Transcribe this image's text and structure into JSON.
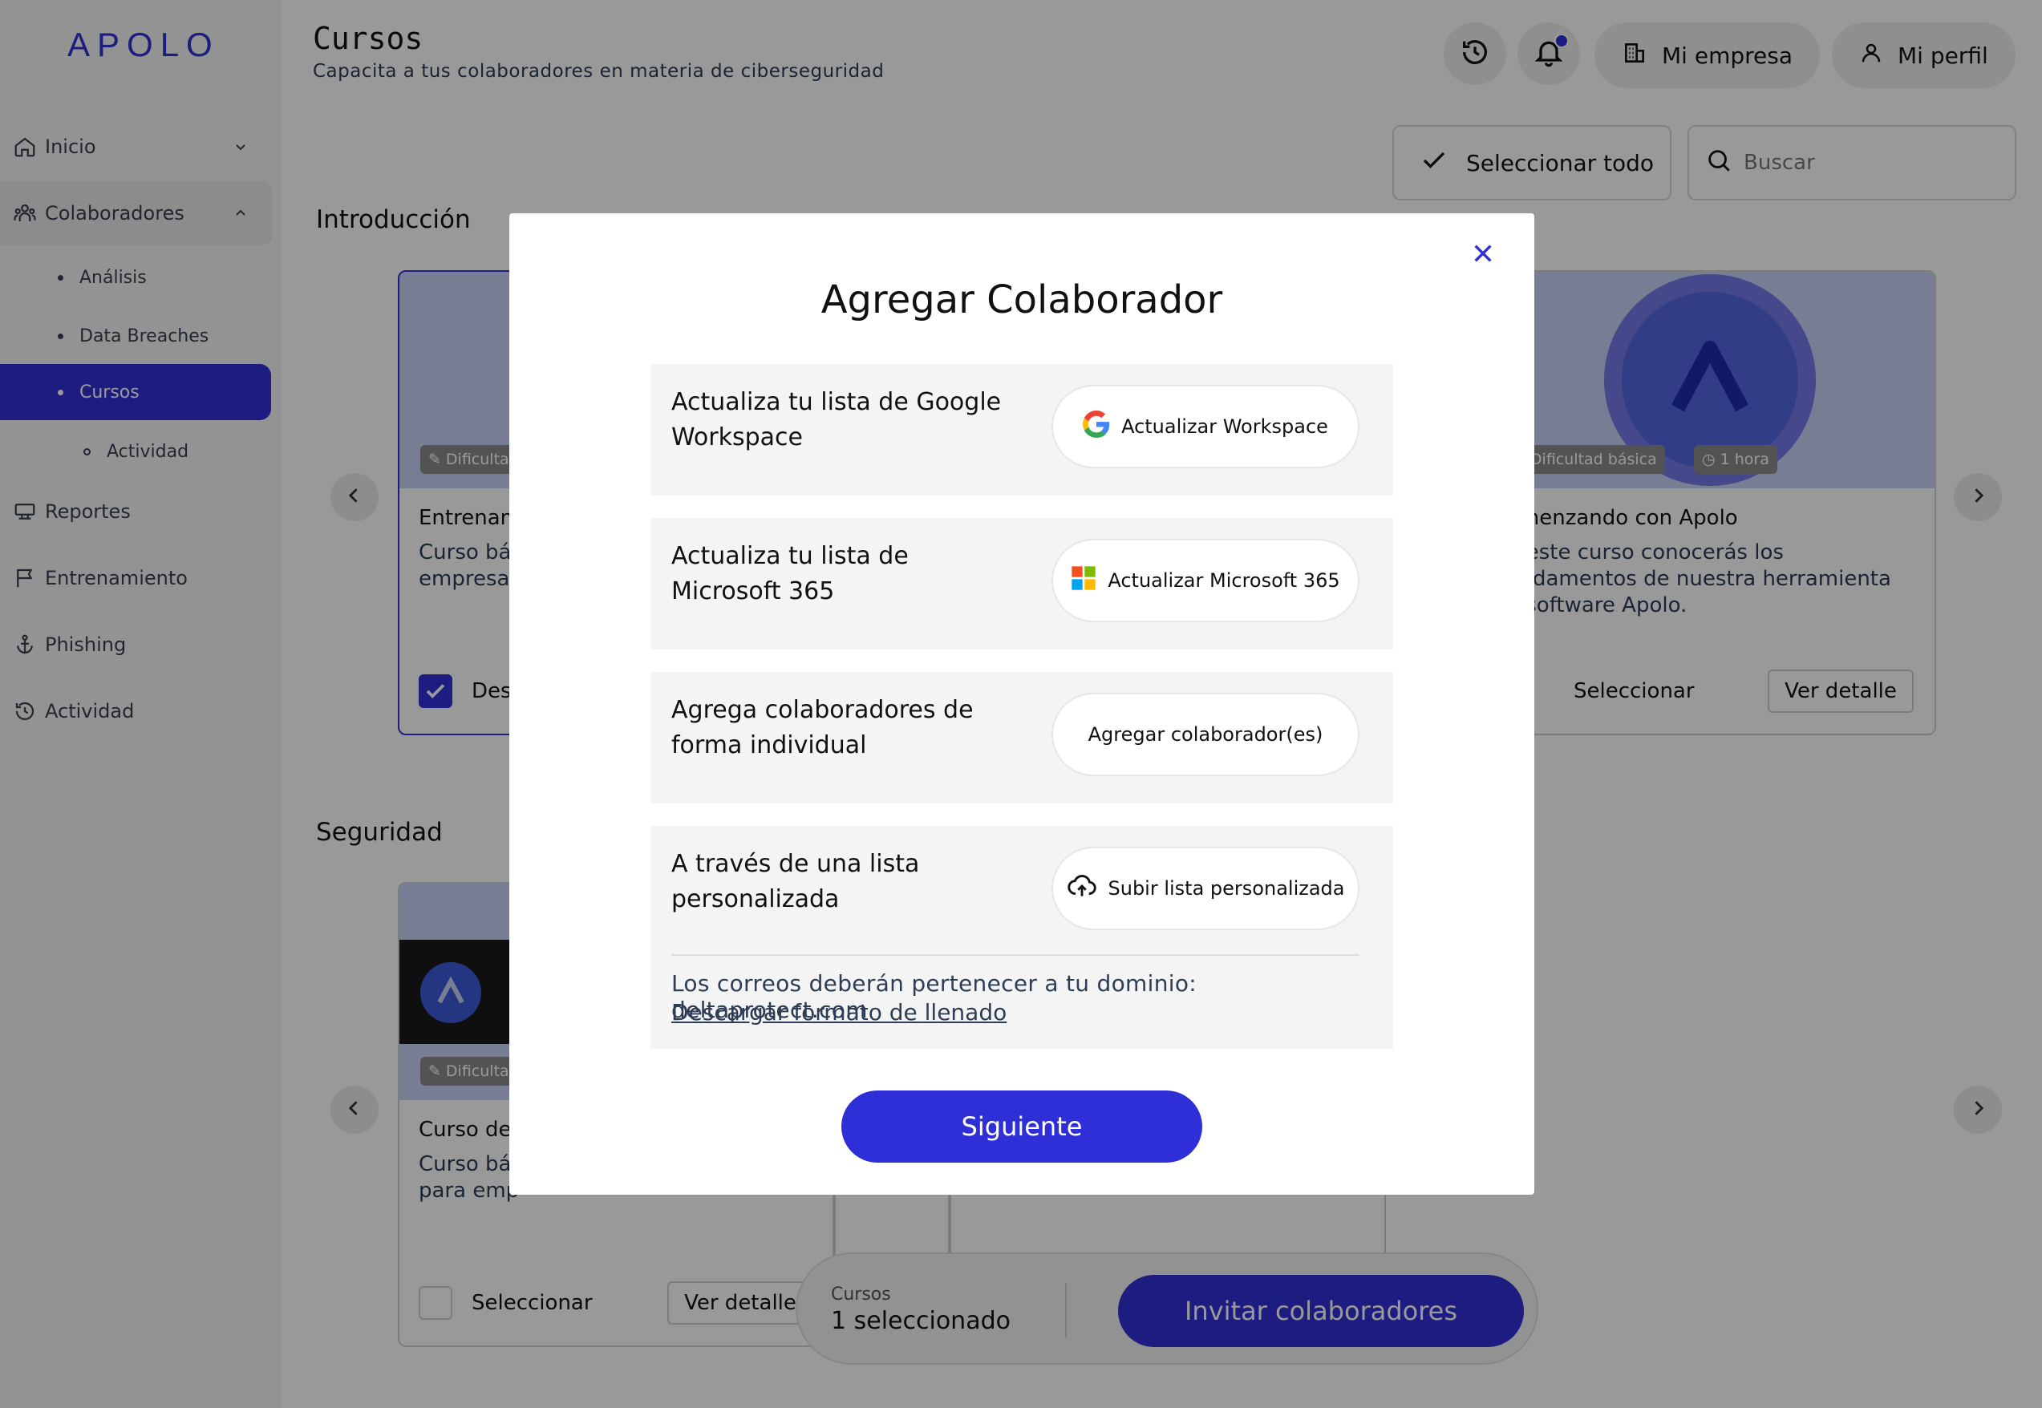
{
  "sidebar": {
    "logo": "APOLO",
    "items": [
      {
        "label": "Inicio"
      },
      {
        "label": "Colaboradores"
      },
      {
        "label": "Reportes"
      },
      {
        "label": "Entrenamiento"
      },
      {
        "label": "Phishing"
      },
      {
        "label": "Actividad"
      }
    ],
    "sub_items": [
      {
        "label": "Análisis"
      },
      {
        "label": "Data Breaches"
      },
      {
        "label": "Cursos"
      },
      {
        "label": "Actividad"
      }
    ]
  },
  "header": {
    "title": "Cursos",
    "subtitle": "Capacita a tus colaboradores en materia de ciberseguridad",
    "company_label": "Mi empresa",
    "profile_label": "Mi perfil"
  },
  "toolbar": {
    "select_all_label": "Seleccionar todo",
    "search_placeholder": "Buscar"
  },
  "sections": [
    {
      "title": "Introducción",
      "cards": [
        {
          "badge": "Dificulta",
          "title": "Entrenam",
          "desc": [
            "Curso bá",
            "empresas"
          ],
          "select_label": "Des"
        },
        {
          "badge": "Dificultad básica",
          "duration": "1 hora",
          "title": "omenzando con Apolo",
          "desc": [
            "n este curso conocerás los",
            "undamentos de nuestra herramienta",
            "e software Apolo."
          ],
          "select_label": "Seleccionar",
          "detail_label": "Ver detalle"
        }
      ]
    },
    {
      "title": "Seguridad",
      "cards": [
        {
          "badge": "Dificulta",
          "title": "Curso de",
          "desc": [
            "Curso bá",
            "para emp"
          ],
          "select_label": "Seleccionar",
          "detail_label": "Ver detalle"
        }
      ]
    }
  ],
  "bottom_bar": {
    "label": "Cursos",
    "value": "1 seleccionado",
    "button": "Invitar colaboradores"
  },
  "modal": {
    "title": "Agregar Colaborador",
    "options": [
      {
        "text": "Actualiza tu lista de Google Workspace",
        "button": "Actualizar Workspace",
        "icon": "google-icon"
      },
      {
        "text": "Actualiza tu lista de Microsoft 365",
        "button": "Actualizar Microsoft 365",
        "icon": "microsoft-icon"
      },
      {
        "text": "Agrega colaboradores de forma individual",
        "button": "Agregar colaborador(es)",
        "icon": ""
      },
      {
        "text": "A través de una lista personalizada",
        "button": "Subir lista personalizada",
        "icon": "upload-cloud-icon"
      }
    ],
    "domain_note": "Los correos deberán pertenecer a tu dominio: deltaprotect.com",
    "download_link": "Descargar formato de llenado",
    "next_button": "Siguiente"
  },
  "colors": {
    "accent": "#2f2fd8",
    "text_secondary": "#2d3d55",
    "overlay": "rgba(0,0,0,0.40)"
  }
}
